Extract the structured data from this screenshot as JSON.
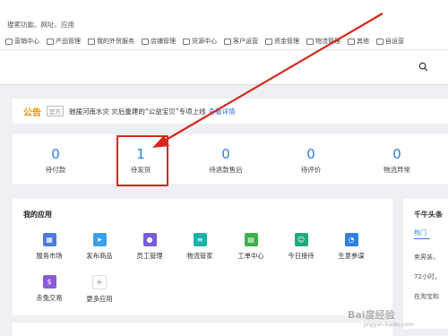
{
  "search": {
    "hint": "搜索功能、网址、应用"
  },
  "bookmarks": [
    "营销中心",
    "产品管理",
    "我的外贸服务",
    "店铺管理",
    "货源中心",
    "客户运营",
    "资金管理",
    "物流管理",
    "其他",
    "自运营"
  ],
  "announcement": {
    "label": "公告",
    "tag": "官方",
    "text": "驰援河南水灾 灾后重建的“公益宝贝”专项上线",
    "link": "查看详情"
  },
  "stats": [
    {
      "value": "0",
      "label": "待付款"
    },
    {
      "value": "1",
      "label": "待发货"
    },
    {
      "value": "0",
      "label": "待退款售后"
    },
    {
      "value": "0",
      "label": "待评价"
    },
    {
      "value": "0",
      "label": "物流异常"
    }
  ],
  "apps": {
    "title": "我的应用",
    "items": [
      {
        "label": "服务市场",
        "icon": "store-icon",
        "color": "#4a7ae0"
      },
      {
        "label": "发布商品",
        "icon": "send-icon",
        "color": "#3aa0e8"
      },
      {
        "label": "员工管理",
        "icon": "user-icon",
        "color": "#7b5bd6"
      },
      {
        "label": "物流管家",
        "icon": "doc-icon",
        "color": "#19b3a8"
      },
      {
        "label": "工单中心",
        "icon": "calendar-icon",
        "color": "#3fb04a"
      },
      {
        "label": "今日接待",
        "icon": "contacts-icon",
        "color": "#21a87e"
      },
      {
        "label": "生意参谋",
        "icon": "chart-icon",
        "color": "#2f7fe0"
      },
      {
        "label": "赤兔交易",
        "icon": "money-icon",
        "color": "#8b5bd6"
      },
      {
        "label": "更多应用",
        "icon": "plus-icon",
        "color": "#ffffff"
      }
    ]
  },
  "news": {
    "title": "千牛头条",
    "tab": "热门",
    "lines": [
      "卖男装，",
      "72小时，",
      "在淘宝和"
    ]
  },
  "watermark": {
    "text": "Bai度经验",
    "sub": "jingyan.baidu.com"
  }
}
